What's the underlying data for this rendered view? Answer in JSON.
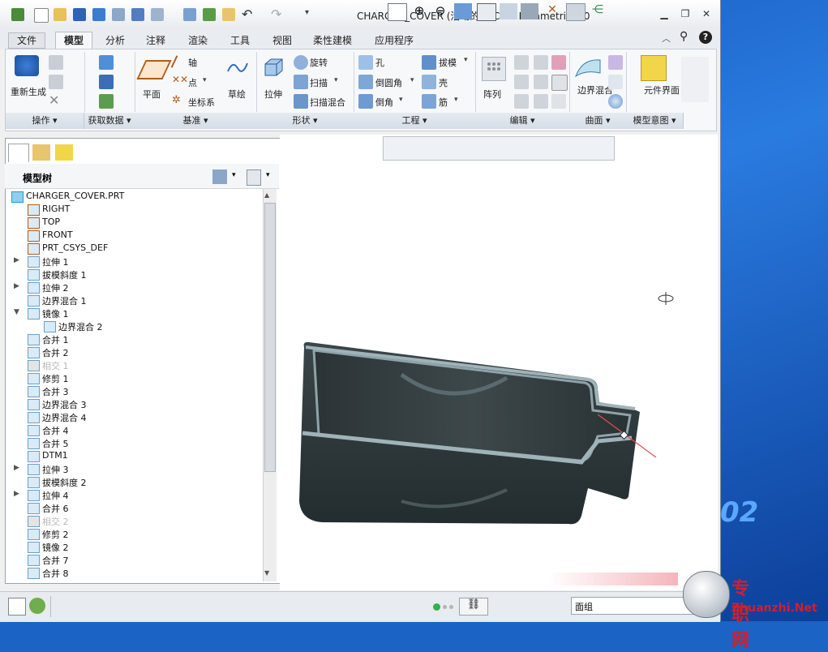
{
  "window": {
    "title": "CHARGER_COVER (活动的) - Creo Parametric 1.0"
  },
  "tabs": [
    {
      "label": "文件",
      "kind": "file"
    },
    {
      "label": "模型",
      "kind": "active"
    },
    {
      "label": "分析"
    },
    {
      "label": "注释"
    },
    {
      "label": "渲染"
    },
    {
      "label": "工具"
    },
    {
      "label": "视图"
    },
    {
      "label": "柔性建模"
    },
    {
      "label": "应用程序"
    }
  ],
  "ribbon": {
    "regenerate": "重新生成",
    "plane": "平面",
    "axis": "轴",
    "point": "点",
    "csys": "坐标系",
    "sketch": "草绘",
    "extrude": "拉伸",
    "revolve": "旋转",
    "sweep": "扫描",
    "swept_blend": "扫描混合",
    "hole": "孔",
    "round": "倒圆角",
    "chamfer": "倒角",
    "draft": "拔模",
    "shell": "壳",
    "rib": "筋",
    "pattern": "阵列",
    "boundary_blend": "边界混合",
    "component_interface": "元件界面",
    "groups": [
      {
        "label": "操作 ▾"
      },
      {
        "label": "获取数据 ▾"
      },
      {
        "label": "基准 ▾"
      },
      {
        "label": "形状 ▾"
      },
      {
        "label": "工程 ▾"
      },
      {
        "label": "编辑 ▾"
      },
      {
        "label": "曲面 ▾"
      },
      {
        "label": "模型意图 ▾"
      }
    ]
  },
  "model_tree": {
    "title": "模型树",
    "items": [
      {
        "label": "CHARGER_COVER.PRT",
        "level": 0,
        "expand": "",
        "dim": false
      },
      {
        "label": "RIGHT",
        "level": 1,
        "expand": "",
        "dim": false
      },
      {
        "label": "TOP",
        "level": 1,
        "expand": "",
        "dim": false
      },
      {
        "label": "FRONT",
        "level": 1,
        "expand": "",
        "dim": false
      },
      {
        "label": "PRT_CSYS_DEF",
        "level": 1,
        "expand": "",
        "dim": false
      },
      {
        "label": "拉伸 1",
        "level": 1,
        "expand": "▶",
        "dim": false
      },
      {
        "label": "拔模斜度 1",
        "level": 1,
        "expand": "",
        "dim": false
      },
      {
        "label": "拉伸 2",
        "level": 1,
        "expand": "▶",
        "dim": false
      },
      {
        "label": "边界混合 1",
        "level": 1,
        "expand": "",
        "dim": false
      },
      {
        "label": "镜像 1",
        "level": 1,
        "expand": "▼",
        "dim": false
      },
      {
        "label": "边界混合 2",
        "level": 2,
        "expand": "",
        "dim": false
      },
      {
        "label": "合并 1",
        "level": 1,
        "expand": "",
        "dim": false
      },
      {
        "label": "合并 2",
        "level": 1,
        "expand": "",
        "dim": false
      },
      {
        "label": "相交 1",
        "level": 1,
        "expand": "",
        "dim": true
      },
      {
        "label": "修剪 1",
        "level": 1,
        "expand": "",
        "dim": false
      },
      {
        "label": "合并 3",
        "level": 1,
        "expand": "",
        "dim": false
      },
      {
        "label": "边界混合 3",
        "level": 1,
        "expand": "",
        "dim": false
      },
      {
        "label": "边界混合 4",
        "level": 1,
        "expand": "",
        "dim": false
      },
      {
        "label": "合并 4",
        "level": 1,
        "expand": "",
        "dim": false
      },
      {
        "label": "合并 5",
        "level": 1,
        "expand": "",
        "dim": false
      },
      {
        "label": "DTM1",
        "level": 1,
        "expand": "",
        "dim": false
      },
      {
        "label": "拉伸 3",
        "level": 1,
        "expand": "▶",
        "dim": false
      },
      {
        "label": "拔模斜度 2",
        "level": 1,
        "expand": "",
        "dim": false
      },
      {
        "label": "拉伸 4",
        "level": 1,
        "expand": "▶",
        "dim": false
      },
      {
        "label": "合并 6",
        "level": 1,
        "expand": "",
        "dim": false
      },
      {
        "label": "相交 2",
        "level": 1,
        "expand": "",
        "dim": true
      },
      {
        "label": "修剪 2",
        "level": 1,
        "expand": "",
        "dim": false
      },
      {
        "label": "镜像 2",
        "level": 1,
        "expand": "",
        "dim": false
      },
      {
        "label": "合并 7",
        "level": 1,
        "expand": "",
        "dim": false
      },
      {
        "label": "合并 8",
        "level": 1,
        "expand": "",
        "dim": false
      }
    ]
  },
  "status": {
    "filter": "面组"
  },
  "watermark": {
    "cn": "专职网",
    "en": "Zhuanzhi.Net"
  },
  "desktop": {
    "deco": "02"
  }
}
